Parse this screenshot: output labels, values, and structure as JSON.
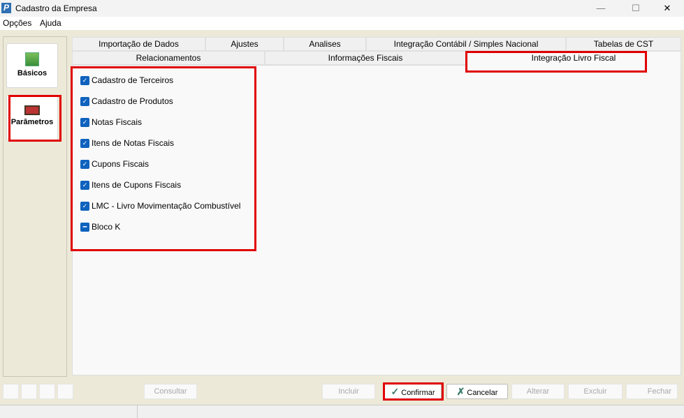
{
  "window": {
    "title": "Cadastro da Empresa",
    "minimize": "—",
    "maximize": "☐",
    "close": "✕"
  },
  "menu": [
    "Opções",
    "Ajuda"
  ],
  "nav": [
    {
      "label": "Básicos"
    },
    {
      "label": "Parâmetros"
    }
  ],
  "tabs_row1": [
    "Importação de Dados",
    "Ajustes",
    "Analises",
    "Integração Contábil / Simples Nacional",
    "Tabelas de CST"
  ],
  "tabs_row2": [
    "Relacionamentos",
    "Informações Fiscais",
    "Integração Livro Fiscal"
  ],
  "active_tab": "Integração Livro Fiscal",
  "checkboxes": [
    {
      "label": "Cadastro de Terceiros",
      "state": "checked"
    },
    {
      "label": "Cadastro de Produtos",
      "state": "checked"
    },
    {
      "label": "Notas Fiscais",
      "state": "checked"
    },
    {
      "label": "Itens de Notas Fiscais",
      "state": "checked"
    },
    {
      "label": "Cupons Fiscais",
      "state": "checked"
    },
    {
      "label": "Itens de Cupons Fiscais",
      "state": "checked"
    },
    {
      "label": "LMC - Livro Movimentação Combustível",
      "state": "checked"
    },
    {
      "label": "Bloco K",
      "state": "indeterminate"
    }
  ],
  "buttons": {
    "consultar": "Consultar",
    "incluir": "Incluir",
    "confirmar": "Confirmar",
    "cancelar": "Cancelar",
    "alterar": "Alterar",
    "excluir": "Excluir",
    "fechar": "Fechar"
  }
}
